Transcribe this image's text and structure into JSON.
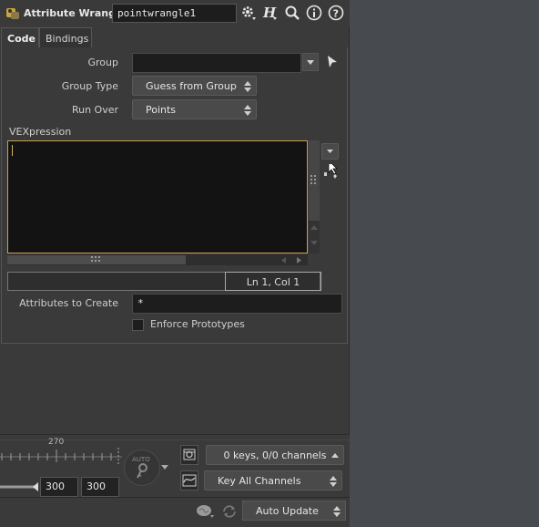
{
  "header": {
    "node_type_label": "Attribute Wrangle",
    "node_name": "pointwrangle1"
  },
  "tabs": [
    {
      "label": "Code",
      "active": true
    },
    {
      "label": "Bindings",
      "active": false
    }
  ],
  "params": {
    "group_label": "Group",
    "group_value": "",
    "group_type_label": "Group Type",
    "group_type_value": "Guess from Group",
    "run_over_label": "Run Over",
    "run_over_value": "Points",
    "vexpression_label": "VEXpression",
    "vexpression_value": "",
    "status_position": "Ln 1, Col 1",
    "attributes_to_create_label": "Attributes to Create",
    "attributes_to_create_value": "*",
    "enforce_prototypes_label": "Enforce Prototypes",
    "enforce_prototypes_checked": false
  },
  "timeline": {
    "tick_label": "270",
    "range_start": "300",
    "range_end": "300",
    "auto_key_label": "AUTO",
    "keys_channels": "0 keys, 0/0 channels",
    "key_all_channels": "Key All Channels"
  },
  "footer": {
    "update_mode": "Auto Update"
  },
  "colors": {
    "editor_focus_border": "#c8a04a",
    "panel_bg": "#3a3a3a",
    "right_bg": "#474b50"
  }
}
